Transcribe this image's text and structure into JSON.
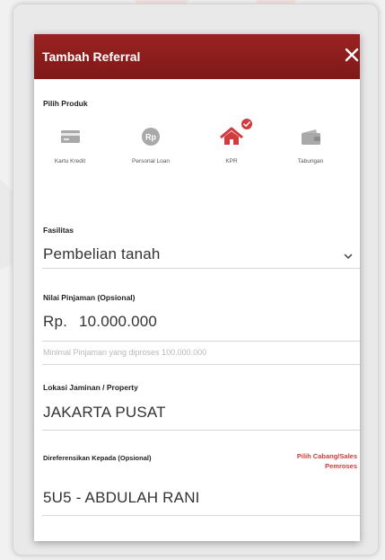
{
  "modal": {
    "title": "Tambah Referral"
  },
  "produk": {
    "label": "Pilih Produk",
    "items": [
      {
        "label": "Kartu Kredit",
        "icon": "credit-card-icon",
        "selected": false
      },
      {
        "label": "Personal Loan",
        "icon": "rupiah-coin-icon",
        "selected": false
      },
      {
        "label": "KPR",
        "icon": "house-icon",
        "selected": true
      },
      {
        "label": "Tabungan",
        "icon": "wallet-icon",
        "selected": false
      }
    ]
  },
  "fasilitas": {
    "label": "Fasilitas",
    "value": "Pembelian tanah"
  },
  "pinjaman": {
    "label": "Nilai Pinjaman (Opsional)",
    "currency": "Rp.",
    "value": "10.000.000",
    "hint": "Minimal Pinjaman yang diproses 100.000.000"
  },
  "lokasi": {
    "label": "Lokasi Jaminan / Property",
    "value": "JAKARTA PUSAT"
  },
  "referensi": {
    "label": "Direferensikan Kepada (Opsional)",
    "link_line1": "Pilih Cabang/Sales",
    "link_line2": "Pemroses",
    "value": "5U5 - ABDULAH RANI"
  },
  "colors": {
    "header": "#8e1f1e",
    "accent_red": "#d23b3b",
    "icon_grey": "#9e9e9e"
  }
}
